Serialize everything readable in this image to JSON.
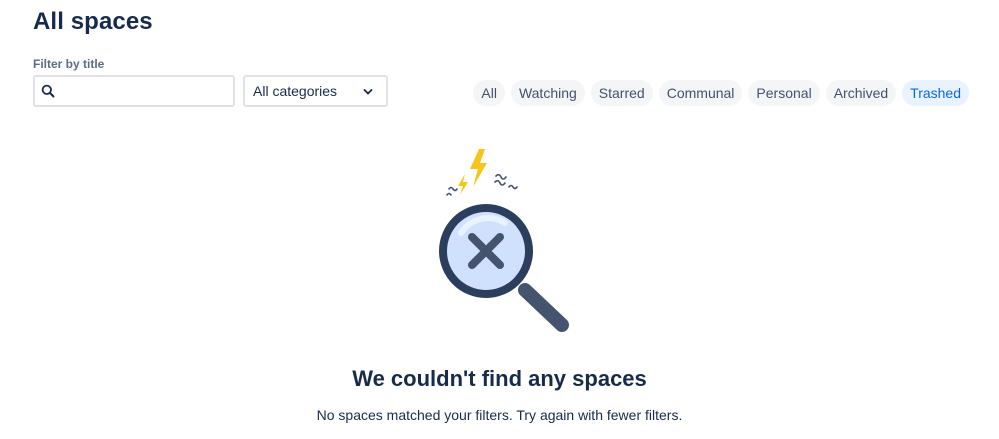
{
  "page": {
    "title": "All spaces"
  },
  "filters": {
    "title_label": "Filter by title",
    "search": {
      "value": "",
      "placeholder": ""
    },
    "category": {
      "selected": "All categories"
    }
  },
  "tabs": [
    {
      "label": "All",
      "active": false
    },
    {
      "label": "Watching",
      "active": false
    },
    {
      "label": "Starred",
      "active": false
    },
    {
      "label": "Communal",
      "active": false
    },
    {
      "label": "Personal",
      "active": false
    },
    {
      "label": "Archived",
      "active": false
    },
    {
      "label": "Trashed",
      "active": true
    }
  ],
  "empty_state": {
    "icon": "magnifier-x-icon",
    "title": "We couldn't find any spaces",
    "message": "No spaces matched your filters. Try again with fewer filters."
  },
  "colors": {
    "text_primary": "#172b4d",
    "tab_active_bg": "#e9f2ff",
    "tab_active_text": "#0c66e4",
    "tab_bg": "#f4f5f7",
    "lens_ring": "#2c3e5d",
    "spark_yellow": "#f5c518"
  }
}
